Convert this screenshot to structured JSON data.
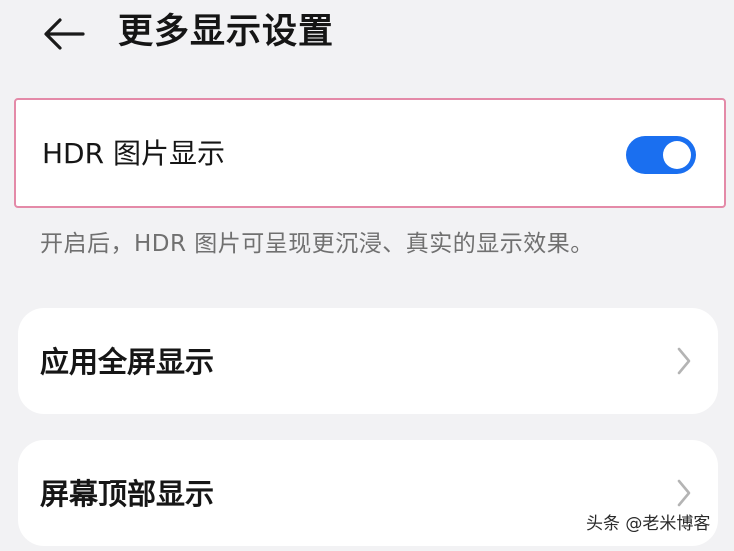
{
  "header": {
    "title": "更多显示设置",
    "back_icon": "back-arrow-icon"
  },
  "hdr": {
    "label": "HDR 图片显示",
    "toggle_on": true,
    "accent_color": "#1a6ff0",
    "highlight_color": "#e48aa8",
    "hint": "开启后，HDR 图片可呈现更沉浸、真实的显示效果。"
  },
  "items": [
    {
      "label": "应用全屏显示",
      "icon": "chevron-right-icon"
    },
    {
      "label": "屏幕顶部显示",
      "icon": "chevron-right-icon"
    }
  ],
  "watermark": "头条 @老米博客"
}
